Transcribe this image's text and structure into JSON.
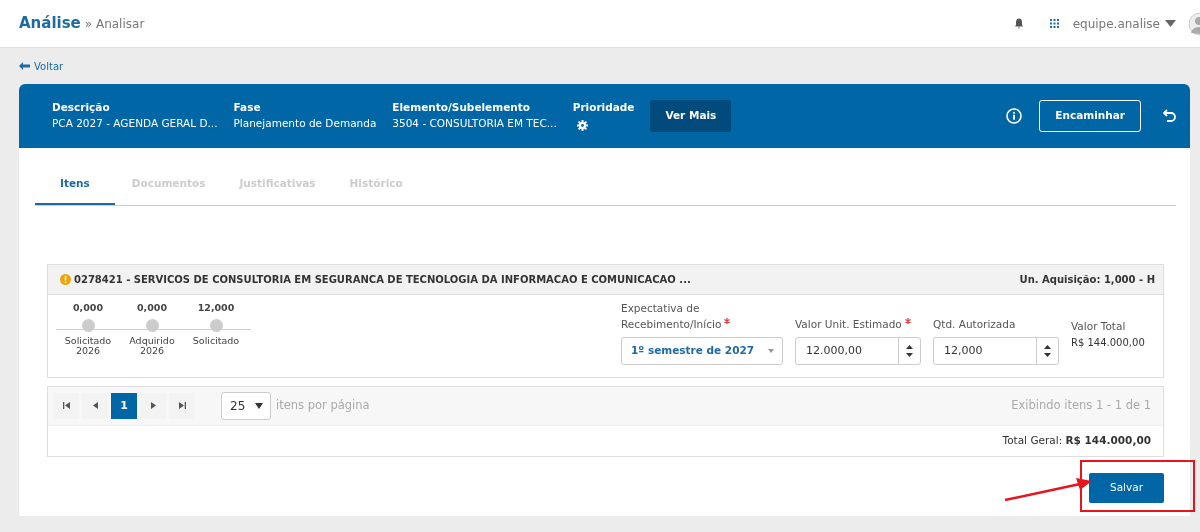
{
  "header": {
    "title": "Análise",
    "breadcrumb": "» Analisar",
    "user": "equipe.analise"
  },
  "back_link": "Voltar",
  "summary": {
    "fields": [
      {
        "label": "Descrição",
        "value": "PCA 2027 - AGENDA GERAL D..."
      },
      {
        "label": "Fase",
        "value": "Planejamento de Demanda"
      },
      {
        "label": "Elemento/Subelemento",
        "value": "3504 - CONSULTORIA EM TEC..."
      },
      {
        "label": "Prioridade",
        "kind": "icon"
      }
    ],
    "more_button": "Ver Mais",
    "forward_button": "Encaminhar"
  },
  "tabs": [
    {
      "label": "Itens",
      "selected": true
    },
    {
      "label": "Documentos",
      "selected": false
    },
    {
      "label": "Justificativas",
      "selected": false
    },
    {
      "label": "Histórico",
      "selected": false
    }
  ],
  "item": {
    "title": "0278421 - SERVICOS DE CONSULTORIA EM SEGURANCA DE TECNOLOGIA DA INFORMACAO E COMUNICACAO ...",
    "unit": "Un. Aquisição: 1,000 - H",
    "timeline": [
      {
        "value": "0,000",
        "label": "Solicitado 2026"
      },
      {
        "value": "0,000",
        "label": "Adquirido 2026"
      },
      {
        "value": "12,000",
        "label": "Solicitado"
      }
    ],
    "fields": [
      {
        "kind": "select",
        "label": "Expectativa de Recebimento/Início",
        "required": true,
        "value": "1º semestre de 2027"
      },
      {
        "kind": "number",
        "label": "Valor Unit. Estimado",
        "required": true,
        "value": "12.000,00"
      },
      {
        "kind": "number",
        "label": "Qtd. Autorizada",
        "required": false,
        "value": "12,000"
      },
      {
        "kind": "text",
        "label": "Valor Total",
        "value": "R$ 144.000,00"
      }
    ]
  },
  "pager": {
    "pages": [
      {
        "label": "1",
        "selected": true
      }
    ],
    "per_page": "25",
    "per_page_label": "itens por página",
    "summary": "Exibindo itens 1 - 1 de 1"
  },
  "total": "Total Geral: **R$ 144.000,00**",
  "save_button": "Salvar"
}
